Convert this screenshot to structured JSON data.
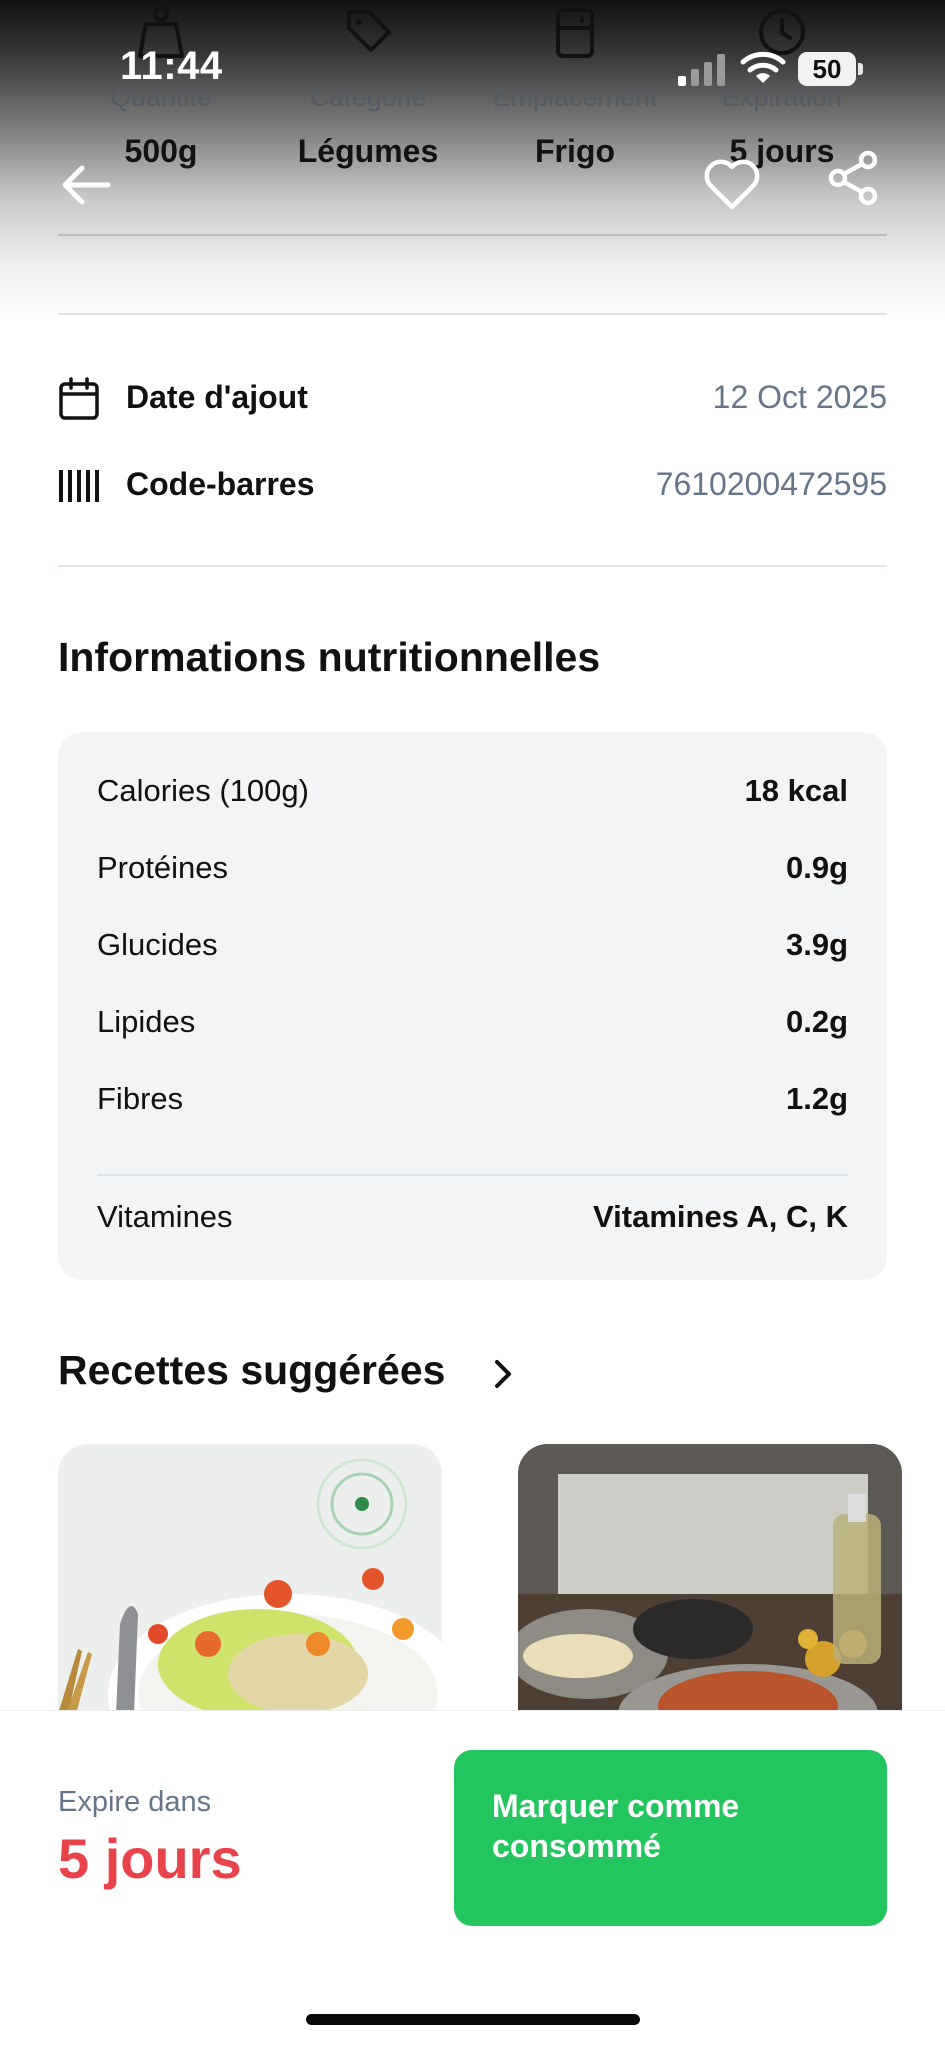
{
  "status_bar": {
    "time": "11:44",
    "battery": "50"
  },
  "header_stats": [
    {
      "icon": "weight-icon",
      "label": "Quantité",
      "value": "500g"
    },
    {
      "icon": "tag-icon",
      "label": "Catégorie",
      "value": "Légumes"
    },
    {
      "icon": "fridge-icon",
      "label": "Emplacement",
      "value": "Frigo"
    },
    {
      "icon": "clock-icon",
      "label": "Expiration",
      "value": "5 jours"
    }
  ],
  "info": {
    "date_label": "Date d'ajout",
    "date_value": "12 Oct 2025",
    "barcode_label": "Code-barres",
    "barcode_value": "7610200472595"
  },
  "nutrition": {
    "title": "Informations nutritionnelles",
    "rows": [
      {
        "label": "Calories (100g)",
        "value": "18 kcal"
      },
      {
        "label": "Protéines",
        "value": "0.9g"
      },
      {
        "label": "Glucides",
        "value": "3.9g"
      },
      {
        "label": "Lipides",
        "value": "0.2g"
      },
      {
        "label": "Fibres",
        "value": "1.2g"
      }
    ],
    "vitamins_label": "Vitamines",
    "vitamins_value": "Vitamines A, C, K"
  },
  "recipes": {
    "title": "Recettes suggérées"
  },
  "footer": {
    "expire_label": "Expire dans",
    "expire_value": "5 jours",
    "consume_button": "Marquer comme consommé"
  },
  "colors": {
    "accent_green": "#22c55e",
    "expire_red": "#e8434a",
    "muted_text": "#66758a"
  }
}
